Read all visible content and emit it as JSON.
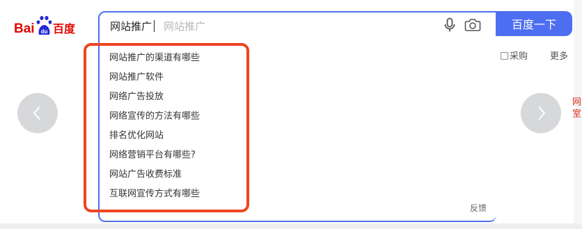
{
  "logo": {
    "text": "Bai",
    "cn": "百度",
    "paw": "du"
  },
  "search": {
    "query": "网站推广",
    "placeholder": "网站推广",
    "button_label": "百度一下"
  },
  "suggestions": [
    "网站推广的渠道有哪些",
    "网站推广软件",
    "网络广告投放",
    "网络宣传的方法有哪些",
    "排名优化网站",
    "网络营销平台有哪些?",
    "网站广告收费标准",
    "互联网宣传方式有哪些"
  ],
  "feedback_label": "反馈",
  "nav": {
    "procure_label": "采购",
    "more_label": "更多"
  },
  "edge_text": "网\n室",
  "colors": {
    "brand_blue": "#4e6ef2",
    "highlight_red": "#ee4422",
    "logo_red": "#e10602",
    "logo_blue": "#2529d8"
  },
  "icons": [
    "mic-icon",
    "camera-icon",
    "chevron-left-icon",
    "chevron-right-icon",
    "procure-icon"
  ]
}
